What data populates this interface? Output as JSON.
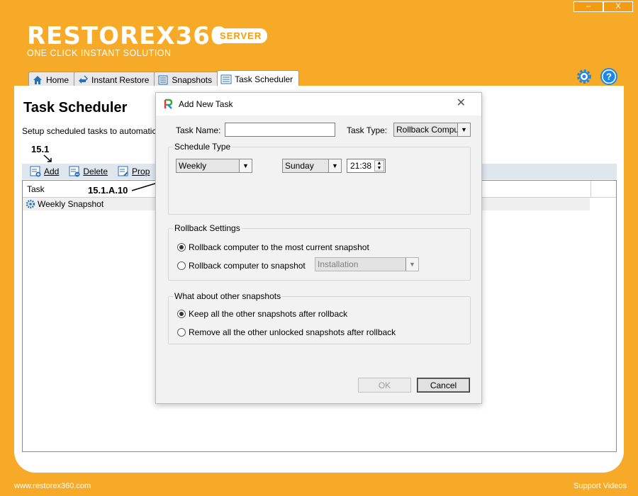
{
  "window": {
    "minimize": "–",
    "close": "X"
  },
  "logo": {
    "title": "RESTOREX360",
    "badge": "SERVER",
    "tagline": "ONE CLICK INSTANT SOLUTION"
  },
  "tabs": [
    {
      "label": "Home",
      "icon": "home-icon"
    },
    {
      "label": "Instant Restore",
      "icon": "instant-restore-icon"
    },
    {
      "label": "Snapshots",
      "icon": "snapshots-icon"
    },
    {
      "label": "Task Scheduler",
      "icon": "task-scheduler-icon",
      "active": true
    }
  ],
  "page": {
    "title": "Task Scheduler",
    "description": "Setup scheduled tasks to automatically",
    "toolbar": {
      "add": "Add",
      "delete": "Delete",
      "properties": "Prop"
    },
    "list": {
      "column_task": "Task",
      "rows": [
        "Weekly Snapshot"
      ]
    }
  },
  "annotations": {
    "add_marker": "15.1",
    "field_marker": "15.1.A.10"
  },
  "footer": {
    "website": "www.restorex360.com",
    "support": "Support Videos"
  },
  "dialog": {
    "title": "Add New Task",
    "close": "✕",
    "task_name_label": "Task Name:",
    "task_name_value": "",
    "task_type_label": "Task Type:",
    "task_type_value": "Rollback Compute",
    "schedule_group": "Schedule Type",
    "schedule_value": "Weekly",
    "day_value": "Sunday",
    "time_value": "21:38",
    "rollback_group": "Rollback Settings",
    "rollback_option1": "Rollback computer to the most current snapshot",
    "rollback_option2": "Rollback computer to snapshot",
    "rollback_snapshot_value": "Installation",
    "other_group": "What about other snapshots",
    "other_option1": "Keep all the other snapshots after rollback",
    "other_option2": "Remove all the other unlocked snapshots after rollback",
    "ok": "OK",
    "cancel": "Cancel"
  },
  "colors": {
    "accent": "#f7a928",
    "toolbar": "#dfe6ee",
    "icon_blue": "#1e88e5"
  }
}
